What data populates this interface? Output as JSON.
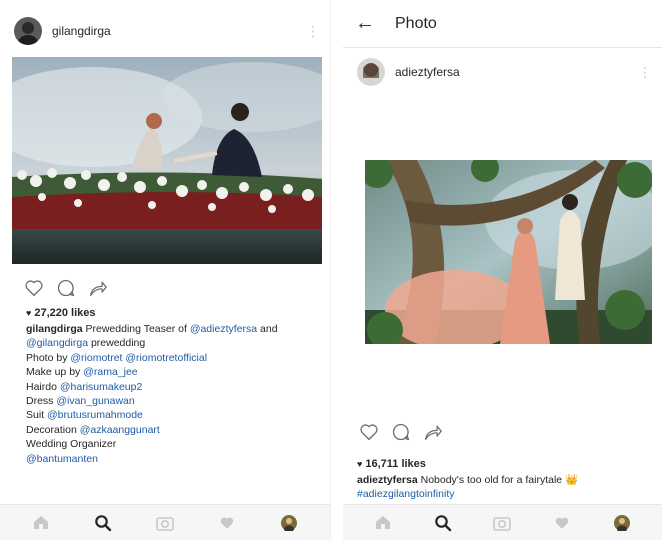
{
  "left": {
    "username": "gilangdirga",
    "likes": "27,220 likes",
    "caption": {
      "username": "gilangdirga",
      "line1_text": " Prewedding Teaser of ",
      "line1_tag": "@adieztyfersa",
      "line1_suffix": " and",
      "line2_tag": "@gilangdirga",
      "line2_text": " prewedding",
      "line3_text": "Photo by ",
      "line3_tag1": "@riomotret",
      "line3_tag2": "@riomotretofficial",
      "line4_text": "Make up by ",
      "line4_tag": "@rama_jee",
      "line5_text": "Hairdo ",
      "line5_tag": "@harisumakeup2",
      "line6_text": "Dress ",
      "line6_tag": "@ivan_gunawan",
      "line7_text": "Suit ",
      "line7_tag": "@brutusrumahmode",
      "line8_text": "Decoration ",
      "line8_tag": "@azkaanggunart",
      "line9_text": "Wedding Organizer",
      "line10_tag": "@bantumanten"
    }
  },
  "right": {
    "title": "Photo",
    "username": "adieztyfersa",
    "likes": "16,711 likes",
    "caption": {
      "username": "adieztyfersa",
      "text": " Nobody's too old for a fairytale ",
      "emoji": "👑",
      "hashtag": "#adiezgilangtoinfinity"
    }
  },
  "icons": {
    "more": "more-vertical-icon",
    "like": "heart-outline-icon",
    "comment": "comment-icon",
    "share": "share-arrow-icon",
    "back": "back-arrow-icon",
    "home": "home-icon",
    "search": "search-icon",
    "camera": "camera-icon",
    "activity": "heart-icon",
    "profile": "profile-avatar-icon"
  },
  "colors": {
    "link": "#1e5ca6",
    "text": "#262626",
    "tabbar": "#f6f6f6"
  }
}
